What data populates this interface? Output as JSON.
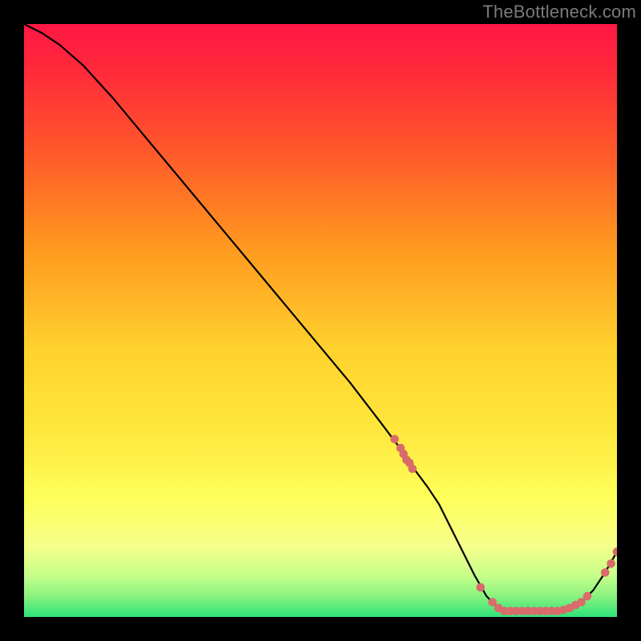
{
  "watermark": "TheBottleneck.com",
  "colors": {
    "frame": "#000000",
    "line": "#000000",
    "point": "#d96b6b",
    "gradient_top": "#ff1744",
    "gradient_mid1": "#ff9a1f",
    "gradient_mid2": "#ffe63b",
    "gradient_mid3": "#f6ff8a",
    "gradient_bottom": "#2ee37a",
    "watermark": "#7a7a7a"
  },
  "chart_data": {
    "type": "line",
    "title": "",
    "xlabel": "",
    "ylabel": "",
    "xlim": [
      0,
      100
    ],
    "ylim": [
      0,
      100
    ],
    "x": [
      0,
      3,
      6,
      10,
      15,
      20,
      25,
      30,
      35,
      40,
      45,
      50,
      55,
      60,
      63,
      65,
      68,
      70,
      72,
      74,
      76,
      78,
      80,
      82,
      84,
      86,
      88,
      90,
      92,
      94,
      96,
      98,
      100
    ],
    "values": [
      100,
      98.5,
      96.5,
      93,
      87.5,
      81.5,
      75.5,
      69.5,
      63.5,
      57.5,
      51.5,
      45.5,
      39.5,
      33,
      29,
      26,
      22,
      19,
      15,
      11,
      7,
      3.5,
      1.5,
      1,
      1,
      1,
      1,
      1,
      1.5,
      2.5,
      4.5,
      7.5,
      11
    ],
    "points": [
      {
        "x": 62.5,
        "y": 30
      },
      {
        "x": 63.5,
        "y": 28.5
      },
      {
        "x": 64,
        "y": 27.5
      },
      {
        "x": 64.5,
        "y": 26.5
      },
      {
        "x": 65,
        "y": 26
      },
      {
        "x": 65.5,
        "y": 25
      },
      {
        "x": 77,
        "y": 5
      },
      {
        "x": 79,
        "y": 2.5
      },
      {
        "x": 80,
        "y": 1.5
      },
      {
        "x": 81,
        "y": 1
      },
      {
        "x": 82,
        "y": 1
      },
      {
        "x": 83,
        "y": 1
      },
      {
        "x": 84,
        "y": 1
      },
      {
        "x": 85,
        "y": 1
      },
      {
        "x": 86,
        "y": 1
      },
      {
        "x": 87,
        "y": 1
      },
      {
        "x": 88,
        "y": 1
      },
      {
        "x": 89,
        "y": 1
      },
      {
        "x": 90,
        "y": 1
      },
      {
        "x": 91,
        "y": 1.2
      },
      {
        "x": 92,
        "y": 1.5
      },
      {
        "x": 93,
        "y": 2
      },
      {
        "x": 94,
        "y": 2.5
      },
      {
        "x": 95,
        "y": 3.5
      },
      {
        "x": 98,
        "y": 7.5
      },
      {
        "x": 99,
        "y": 9
      },
      {
        "x": 100,
        "y": 11
      }
    ]
  }
}
